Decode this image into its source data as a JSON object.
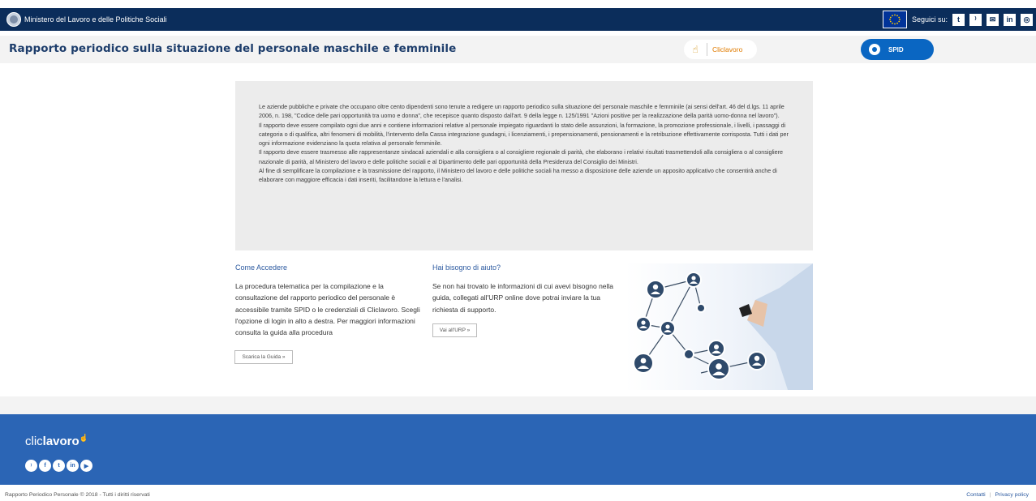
{
  "topbar": {
    "ministry": "Ministero del Lavoro e delle Politiche Sociali",
    "follow_label": "Seguici su:",
    "social": [
      "twitter-icon",
      "rss-icon",
      "mail-icon",
      "linkedin-icon",
      "instagram-icon"
    ],
    "social_glyphs": [
      "t",
      "⁾",
      "✉",
      "in",
      "◎"
    ],
    "bg_color": "#0b2d5b"
  },
  "header": {
    "title": "Rapporto periodico sulla situazione del personale maschile e femminile",
    "cliclavoro_label": "Cliclavoro",
    "spid_label": "SPID",
    "spid_color": "#0a66c2"
  },
  "intro": {
    "paragraphs": [
      "Le aziende pubbliche e private che occupano oltre cento dipendenti sono tenute a redigere un rapporto periodico sulla situazione del personale maschile e femminile (ai sensi dell'art. 46 del d.lgs. 11 aprile 2006, n. 198, \"Codice delle pari opportunità tra uomo e donna\", che recepisce quanto disposto dall'art. 9 della legge n. 125/1991 \"Azioni positive per la realizzazione della parità uomo-donna nel lavoro\").",
      "Il rapporto deve essere compilato ogni due anni e contiene informazioni relative al personale impiegato riguardanti lo stato delle assunzioni, la formazione, la promozione professionale, i livelli, i passaggi di categoria o di qualifica, altri fenomeni di mobilità, l'intervento della Cassa integrazione guadagni, i licenziamenti, i prepensionamenti, pensionamenti e la retribuzione effettivamente corrisposta. Tutti i dati per ogni informazione evidenziano la quota relativa al personale femminile.",
      "Il rapporto deve essere trasmesso alle rappresentanze sindacali aziendali e alla consigliera o al consigliere regionale di parità, che elaborano i relativi risultati trasmettendoli alla consigliera o al consigliere nazionale di parità, al Ministero del lavoro e delle politiche sociali e al Dipartimento delle pari opportunità della Presidenza del Consiglio dei Ministri.",
      "Al fine di semplificare la compilazione e la trasmissione del rapporto, il Ministero del lavoro e delle politiche sociali ha messo a disposizione delle aziende un apposito applicativo che consentirà anche di elaborare con maggiore efficacia i dati inseriti, facilitandone la lettura e l'analisi."
    ]
  },
  "access": {
    "heading": "Come Accedere",
    "body": "La procedura telematica per la compilazione e la consultazione del rapporto periodico del personale è accessibile tramite SPID o le credenziali di Cliclavoro. Scegli l'opzione di login in alto a destra. Per maggiori informazioni consulta la guida alla procedura",
    "button": "Scarica la Guida »"
  },
  "help": {
    "heading": "Hai bisogno di aiuto?",
    "body": "Se non hai trovato le informazioni di cui avevi bisogno nella guida, collegati all'URP online dove potrai inviare la tua richiesta di supporto.",
    "button": "Vai all'URP »"
  },
  "footer": {
    "logo_light": "clic",
    "logo_bold": "lavoro",
    "social": [
      "rss-icon",
      "facebook-icon",
      "twitter-icon",
      "linkedin-icon",
      "youtube-icon"
    ],
    "social_glyphs": [
      "⁾",
      "f",
      "t",
      "in",
      "▶"
    ],
    "bg_color": "#2b65b5"
  },
  "bottom": {
    "copyright": "Rapporto Periodico Personale © 2018 - Tutti i diritti riservati",
    "links": [
      "Contatti",
      "Privacy policy"
    ]
  }
}
